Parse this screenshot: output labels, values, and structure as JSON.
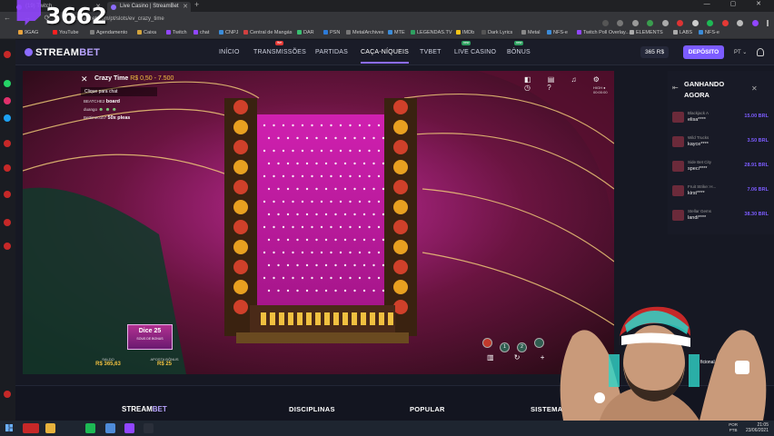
{
  "browser": {
    "tabs": [
      {
        "label": "(19) Twitch",
        "active": false
      },
      {
        "label": "Live Casino | StreamBet",
        "active": true
      }
    ],
    "new_tab": "+",
    "window_controls": "— ▢ ✕",
    "url": "streambet.com/pt/slots/ev_crazy_time",
    "nav_buttons": "← → ⟳",
    "bookmarks": [
      "9GAG",
      "YouTube",
      "Agendamento",
      "Caixa",
      "Twitch",
      "chat",
      "CNPJ",
      "Central de Mangás",
      "DAR",
      "PSN",
      "MetalArchives",
      "MTE",
      "LEGENDAS.TV",
      "IMDb",
      "Dark Lyrics",
      "Metal",
      "NFS-e",
      "Twitch Poll Overlay...",
      "ELEMENTS",
      "LABS",
      "NFS-e"
    ],
    "bookmark_colors": [
      "#e8a33d",
      "#ff2020",
      "#7f7f7f",
      "#d3a43c",
      "#9146ff",
      "#9146ff",
      "#3b8cd9",
      "#d04040",
      "#38c070",
      "#2d7bd8",
      "#777",
      "#3b8cd9",
      "#2ea060",
      "#f5c518",
      "#555",
      "#888",
      "#3b8cd9",
      "#9146ff",
      "#aaa",
      "#aaa",
      "#3b8cd9"
    ]
  },
  "overlay": {
    "counter": "3662",
    "overlay_label": "ficional"
  },
  "site": {
    "logo_a": "STREAM",
    "logo_b": "BET",
    "nav": [
      {
        "label": "INÍCIO",
        "badge": ""
      },
      {
        "label": "TRANSMISSÕES",
        "badge": "live"
      },
      {
        "label": "PARTIDAS",
        "badge": ""
      },
      {
        "label": "CAÇA-NÍQUEIS",
        "badge": ""
      },
      {
        "label": "TVBET",
        "badge": ""
      },
      {
        "label": "LIVE CASINO",
        "badge": "new"
      },
      {
        "label": "BÔNUS",
        "badge": "new"
      }
    ],
    "balance": "365 R$",
    "deposit": "DEPÓSITO",
    "lang": "PT ⌄"
  },
  "game": {
    "title": "Crazy Time",
    "limits": "R$ 0,50 - 7.500",
    "close": "✕",
    "icons": "◧ ▤ ♫ ⚙ ◷ ?",
    "clock": "HIGH ● 00:00:00",
    "chat_prompt": "Clique para chat",
    "chat": [
      {
        "user": "BEATCHE2",
        "msg": "board"
      },
      {
        "user": "duango",
        "msg": "☻ ☻ ☻"
      },
      {
        "user": "Bettimeo1b7",
        "msg": "50x pleas"
      }
    ],
    "promo_top": "Dice",
    "promo_num": "25",
    "promo_sub": "SOUS DE BONUS",
    "balance_label": "SALDO",
    "balance_value": "R$ 365,63",
    "bet_label": "APOSTA BÔNUS",
    "bet_value": "R$ 25",
    "chips": [
      "",
      "1",
      "2",
      ""
    ],
    "controls": "▥ ↻ +"
  },
  "winners": {
    "title": "GANHANDO AGORA",
    "close": "✕",
    "rows": [
      {
        "game": "Blackjack A",
        "user": "elisa****",
        "amount": "15.00 BRL"
      },
      {
        "game": "Wild Trucks",
        "user": "kayce****",
        "amount": "3.50 BRL"
      },
      {
        "game": "Side Bet City",
        "user": "speci****",
        "amount": "28.91 BRL"
      },
      {
        "game": "Fruit Strike: H...",
        "user": "kirst****",
        "amount": "7.06 BRL"
      },
      {
        "game": "Stellar Gems",
        "user": "landi****",
        "amount": "38.30 BRL"
      }
    ]
  },
  "footer": {
    "logo_a": "STREAM",
    "logo_b": "BET",
    "headings": [
      "DISCIPLINAS",
      "POPULAR",
      "SISTEMA"
    ]
  },
  "taskbar": {
    "lang": "POR\nPTB",
    "time": "21:05",
    "date": "23/06/2021",
    "apps": [
      "#c62828",
      "#e7b23c",
      "#1db954",
      "#4e8bd8",
      "#9146ff",
      "#2a2f3a"
    ]
  },
  "colors": {
    "accent": "#7c5cff",
    "deposit": "#7c5cff",
    "gold": "#f0c040"
  }
}
